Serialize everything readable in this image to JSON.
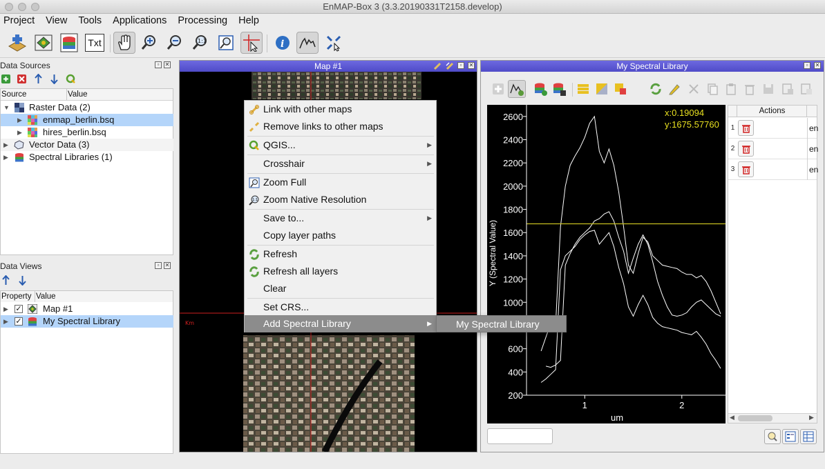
{
  "window": {
    "title": "EnMAP-Box 3 (3.3.20190331T2158.develop)"
  },
  "menubar": {
    "items": [
      "Project",
      "View",
      "Tools",
      "Applications",
      "Processing",
      "Help"
    ]
  },
  "toolbar": {
    "icons": [
      "add-datasource-icon",
      "new-map-icon",
      "new-speclib-icon",
      "new-textview-icon",
      "pan-icon",
      "zoom-in-icon",
      "zoom-out-icon",
      "zoom-native-icon",
      "zoom-full-icon",
      "crosshair-select-icon",
      "identify-icon",
      "spectral-profile-icon",
      "move-center-icon"
    ],
    "txt_label": "Txt"
  },
  "data_sources": {
    "title": "Data Sources",
    "columns": [
      "Source",
      "Value"
    ],
    "items": [
      {
        "label": "Raster Data (2)"
      },
      {
        "label": "enmap_berlin.bsq"
      },
      {
        "label": "hires_berlin.bsq"
      },
      {
        "label": "Vector Data (3)"
      },
      {
        "label": "Spectral Libraries (1)"
      }
    ]
  },
  "data_views": {
    "title": "Data Views",
    "columns": [
      "Property",
      "Value"
    ],
    "items": [
      {
        "label": "Map #1"
      },
      {
        "label": "My Spectral Library"
      }
    ]
  },
  "map_dock": {
    "title": "Map #1",
    "scale_label": "Km"
  },
  "context_menu": {
    "items": [
      {
        "label": "Link with other maps"
      },
      {
        "label": "Remove links to other maps"
      },
      {
        "label": "QGIS..."
      },
      {
        "label": "Crosshair"
      },
      {
        "label": "Zoom Full"
      },
      {
        "label": "Zoom Native Resolution"
      },
      {
        "label": "Save to..."
      },
      {
        "label": "Copy layer paths"
      },
      {
        "label": "Refresh"
      },
      {
        "label": "Refresh all layers"
      },
      {
        "label": "Clear"
      },
      {
        "label": "Set CRS..."
      },
      {
        "label": "Add Spectral Library"
      }
    ],
    "submenu": {
      "label": "My Spectral Library"
    }
  },
  "speclib_dock": {
    "title": "My Spectral Library",
    "cursor": {
      "x": "x:0.19094",
      "y": "y:1675.57760"
    },
    "actions_header": "Actions",
    "rows": [
      {
        "num": "1",
        "value": "en"
      },
      {
        "num": "2",
        "value": "en"
      },
      {
        "num": "3",
        "value": "en"
      }
    ],
    "filter_value": ""
  },
  "chart_data": {
    "type": "line",
    "xlabel": "um",
    "ylabel": "Y (Spectral Value)",
    "xlim": [
      0.4,
      2.45
    ],
    "ylim": [
      200,
      2700
    ],
    "x_ticks": [
      1,
      2
    ],
    "y_ticks": [
      200,
      400,
      600,
      800,
      1000,
      1200,
      1400,
      1600,
      1800,
      2000,
      2200,
      2400,
      2600
    ],
    "crosshair_y": 1675.5776,
    "series": [
      {
        "x": [
          0.55,
          0.6,
          0.65,
          0.7,
          0.75,
          0.8,
          0.85,
          0.9,
          0.95,
          1.0,
          1.05,
          1.1,
          1.15,
          1.2,
          1.25,
          1.3,
          1.35,
          1.4,
          1.45,
          1.5,
          1.55,
          1.6,
          1.65,
          1.7,
          1.75,
          1.8,
          1.85,
          1.9,
          1.95,
          2.0,
          2.05,
          2.1,
          2.15,
          2.2,
          2.25,
          2.3,
          2.35,
          2.4
        ],
        "y": [
          580,
          700,
          820,
          800,
          1650,
          2000,
          2180,
          2260,
          2330,
          2420,
          2540,
          2600,
          2300,
          2200,
          2320,
          2180,
          1950,
          1650,
          1320,
          1250,
          1420,
          1560,
          1520,
          1400,
          1360,
          1320,
          1310,
          1300,
          1290,
          1260,
          1240,
          1240,
          1210,
          1230,
          1180,
          1100,
          1000,
          900
        ]
      },
      {
        "x": [
          0.6,
          0.65,
          0.7,
          0.75,
          0.8,
          0.85,
          0.9,
          0.95,
          1.0,
          1.05,
          1.1,
          1.15,
          1.2,
          1.25,
          1.3,
          1.35,
          1.4,
          1.45,
          1.5,
          1.55,
          1.6,
          1.65,
          1.7,
          1.75,
          1.8,
          1.85,
          1.9,
          1.95,
          2.0,
          2.05,
          2.1,
          2.15,
          2.2,
          2.25,
          2.3,
          2.35,
          2.4
        ],
        "y": [
          450,
          440,
          460,
          500,
          1320,
          1420,
          1500,
          1560,
          1600,
          1640,
          1700,
          1720,
          1760,
          1780,
          1700,
          1560,
          1440,
          1250,
          1380,
          1500,
          1580,
          1500,
          1350,
          1180,
          1060,
          960,
          890,
          880,
          890,
          910,
          960,
          1000,
          1020,
          980,
          940,
          900,
          880
        ]
      },
      {
        "x": [
          0.55,
          0.6,
          0.65,
          0.7,
          0.75,
          0.8,
          0.85,
          0.9,
          0.95,
          1.0,
          1.05,
          1.1,
          1.15,
          1.2,
          1.25,
          1.3,
          1.35,
          1.4,
          1.45,
          1.5,
          1.55,
          1.6,
          1.65,
          1.7,
          1.75,
          1.8,
          1.85,
          1.9,
          1.95,
          2.0,
          2.05,
          2.1,
          2.15,
          2.2,
          2.25,
          2.3,
          2.35,
          2.4
        ],
        "y": [
          310,
          340,
          380,
          420,
          1280,
          1400,
          1440,
          1480,
          1540,
          1580,
          1610,
          1620,
          1500,
          1550,
          1600,
          1480,
          1300,
          1160,
          960,
          880,
          980,
          1060,
          980,
          870,
          820,
          790,
          780,
          770,
          760,
          740,
          730,
          720,
          750,
          700,
          640,
          560,
          500,
          430
        ]
      }
    ]
  }
}
